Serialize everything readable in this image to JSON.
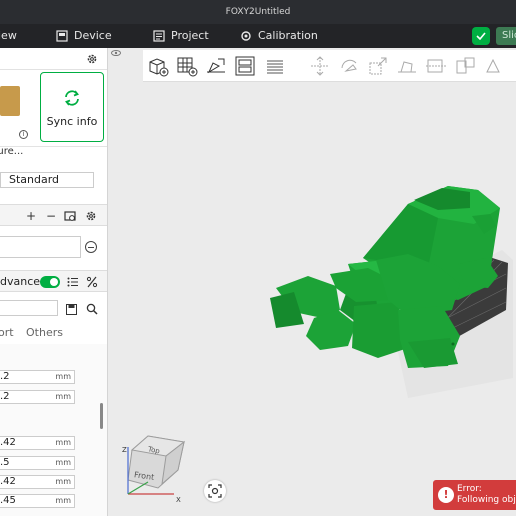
{
  "window": {
    "title": "FOXY2Untitled"
  },
  "menubar": {
    "view_label": "iew",
    "device_label": "Device",
    "project_label": "Project",
    "calibration_label": "Calibration",
    "slice_label": "Slic"
  },
  "sidebar": {
    "filament_label": "cture...",
    "sync_label": "Sync info",
    "process_preset": "Standard",
    "advanced_label": "dvanced",
    "tabs": [
      "ort",
      "Others"
    ],
    "fields": [
      {
        "value": ".2",
        "unit": "mm"
      },
      {
        "value": ".2",
        "unit": "mm"
      },
      {
        "value": ".42",
        "unit": "mm"
      },
      {
        "value": ".5",
        "unit": "mm"
      },
      {
        "value": ".42",
        "unit": "mm"
      },
      {
        "value": ".45",
        "unit": "mm"
      }
    ]
  },
  "viewport": {
    "cube_top": "Top",
    "cube_front": "Front",
    "axis_z": "Z",
    "axis_x": "X",
    "error_title": "Error:",
    "error_body": "Following obje"
  },
  "colors": {
    "accent": "#00ae42",
    "model": "#1ca337",
    "error": "#d23c3c",
    "titlebar": "#2b2d31"
  },
  "icons": {
    "toolbar": [
      "add-object-icon",
      "add-plate-icon",
      "auto-orient-icon",
      "arrange-icon",
      "layers-icon",
      "move-icon",
      "rotate-icon",
      "scale-icon",
      "lay-on-face-icon",
      "cut-icon",
      "split-icon"
    ]
  }
}
